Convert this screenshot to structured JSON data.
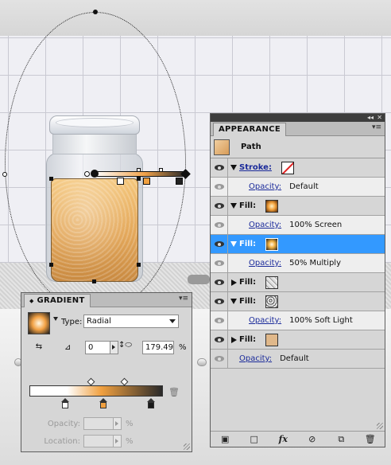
{
  "appearance": {
    "tab": "APPEARANCE",
    "object": "Path",
    "rows": [
      {
        "label": "Stroke:",
        "value": "",
        "swatch": "none"
      },
      {
        "label": "Opacity:",
        "value": "Default"
      },
      {
        "label": "Fill:",
        "value": "",
        "swatch": "radial-orange"
      },
      {
        "label": "Opacity:",
        "value": "100% Screen"
      },
      {
        "label": "Fill:",
        "value": "",
        "swatch": "radial-orange-dark",
        "selected": true
      },
      {
        "label": "Opacity:",
        "value": "50% Multiply"
      },
      {
        "label": "Fill:",
        "value": "",
        "swatch": "texture"
      },
      {
        "label": "Fill:",
        "value": "",
        "swatch": "texture-dark"
      },
      {
        "label": "Opacity:",
        "value": "100% Soft Light"
      },
      {
        "label": "Fill:",
        "value": "",
        "swatch": "tan"
      },
      {
        "label": "Opacity:",
        "value": "Default"
      }
    ],
    "footer_icons": [
      "new-art-icon",
      "clear-appearance-icon",
      "fx-icon",
      "reduce-basic-icon",
      "duplicate-icon",
      "trash-icon"
    ],
    "fx_label": "fx"
  },
  "gradient": {
    "tab": "GRADIENT",
    "type_label": "Type:",
    "type_value": "Radial",
    "angle": "0",
    "aspect": "179.49",
    "aspect_unit": "%",
    "opacity_label": "Opacity:",
    "location_label": "Location:",
    "percent": "%",
    "stops": [
      {
        "color": "#ffffff",
        "location": 28
      },
      {
        "color": "#f0a040",
        "location": 54
      },
      {
        "color": "#1a1a1a",
        "location": 90
      }
    ]
  },
  "colors": {
    "highlight": "#3399ff",
    "panel_bg": "#d6d6d6",
    "link": "#1a2a9a"
  }
}
